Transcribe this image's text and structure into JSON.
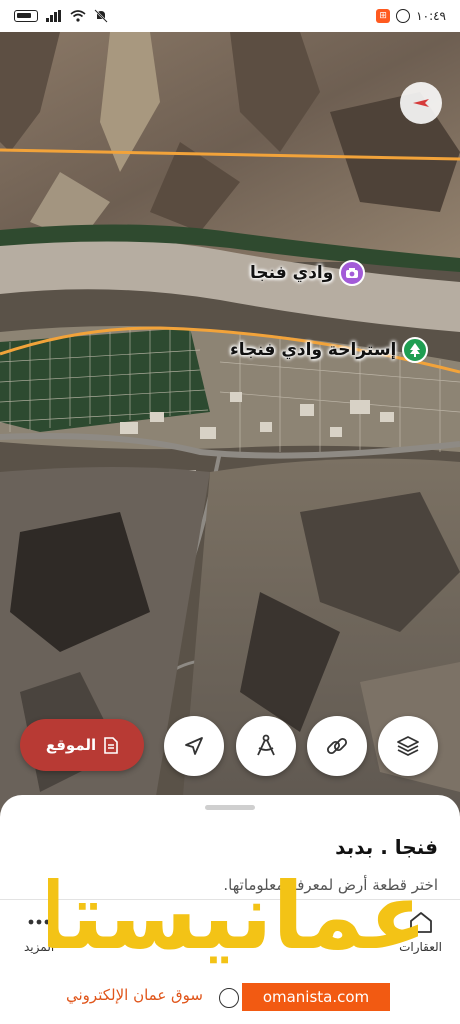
{
  "status_bar": {
    "time": "١٠:٤٩",
    "icons": [
      "battery-icon",
      "signal-icon",
      "wifi-icon",
      "mute-icon",
      "app-notification-icon",
      "whatsapp-icon"
    ]
  },
  "map": {
    "pois": [
      {
        "name": "وادي فنجا",
        "icon": "camera-icon",
        "color": "#a35bd8"
      },
      {
        "name": "إستراحة وادي فنجاء",
        "icon": "tree-icon",
        "color": "#1f9e52"
      }
    ],
    "controls": [
      "layers-icon",
      "link-icon",
      "measure-icon",
      "navigation-arrow-icon"
    ],
    "location_button": {
      "label": "الموقع",
      "icon": "document-icon"
    },
    "colors": {
      "road": "#f2a33a",
      "location_button": "#b83a34"
    }
  },
  "sheet": {
    "title": "فنجا . بدبد",
    "subtitle": "اختر قطعة أرض لمعرفة معلوماتها."
  },
  "nav": {
    "items": [
      {
        "label": "العقارات",
        "icon": "home-icon"
      },
      {
        "label": "المزيد",
        "icon": "more-dots-icon"
      }
    ]
  },
  "watermark": {
    "brand": "عمانيستا",
    "domain": "omanista.com",
    "tagline": "سوق عمان الإلكتروني",
    "colors": {
      "brand": "#f3c316",
      "domain_bg": "#f25a12"
    }
  }
}
